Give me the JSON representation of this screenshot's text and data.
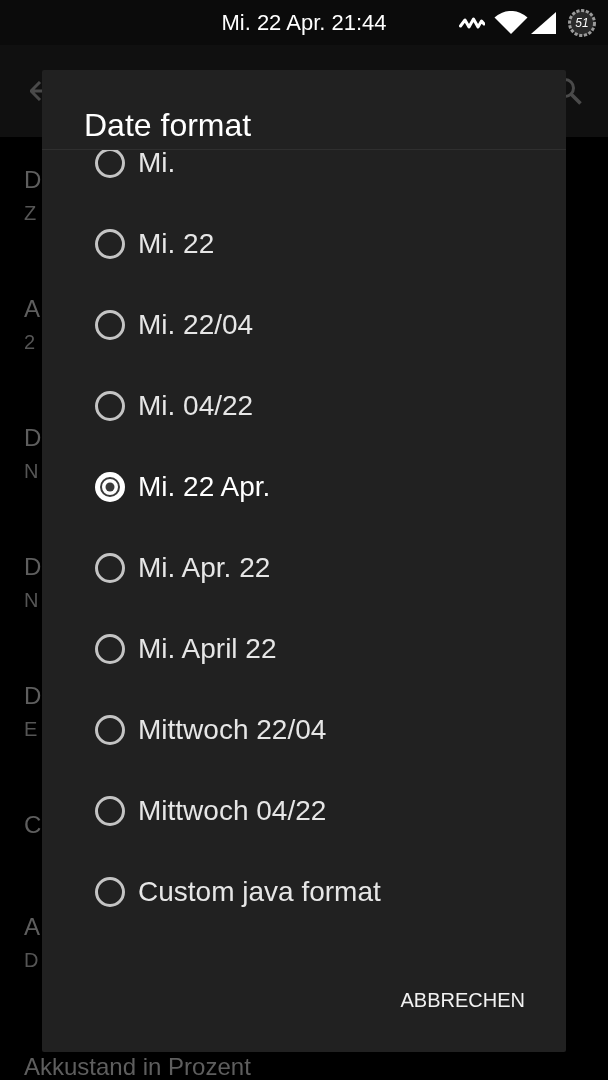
{
  "status_bar": {
    "time": "Mi. 22 Apr. 21:44",
    "battery": "51"
  },
  "settings": [
    {
      "title": "D",
      "summary": "Z"
    },
    {
      "title": "A",
      "summary": "2"
    },
    {
      "title": "D",
      "summary": "N"
    },
    {
      "title": "D",
      "summary": "N"
    },
    {
      "title": "D",
      "summary": "E"
    },
    {
      "title": "C"
    },
    {
      "title": "A",
      "summary": "D"
    },
    {
      "title": "Akkustand in Prozent"
    }
  ],
  "dialog": {
    "title": "Date format",
    "options": [
      {
        "label": "Mi.",
        "selected": false
      },
      {
        "label": "Mi. 22",
        "selected": false
      },
      {
        "label": "Mi. 22/04",
        "selected": false
      },
      {
        "label": "Mi. 04/22",
        "selected": false
      },
      {
        "label": "Mi. 22 Apr.",
        "selected": true
      },
      {
        "label": "Mi. Apr. 22",
        "selected": false
      },
      {
        "label": "Mi. April 22",
        "selected": false
      },
      {
        "label": "Mittwoch 22/04",
        "selected": false
      },
      {
        "label": "Mittwoch 04/22",
        "selected": false
      },
      {
        "label": "Custom java format",
        "selected": false
      }
    ],
    "buttons": [
      "ABBRECHEN"
    ]
  }
}
